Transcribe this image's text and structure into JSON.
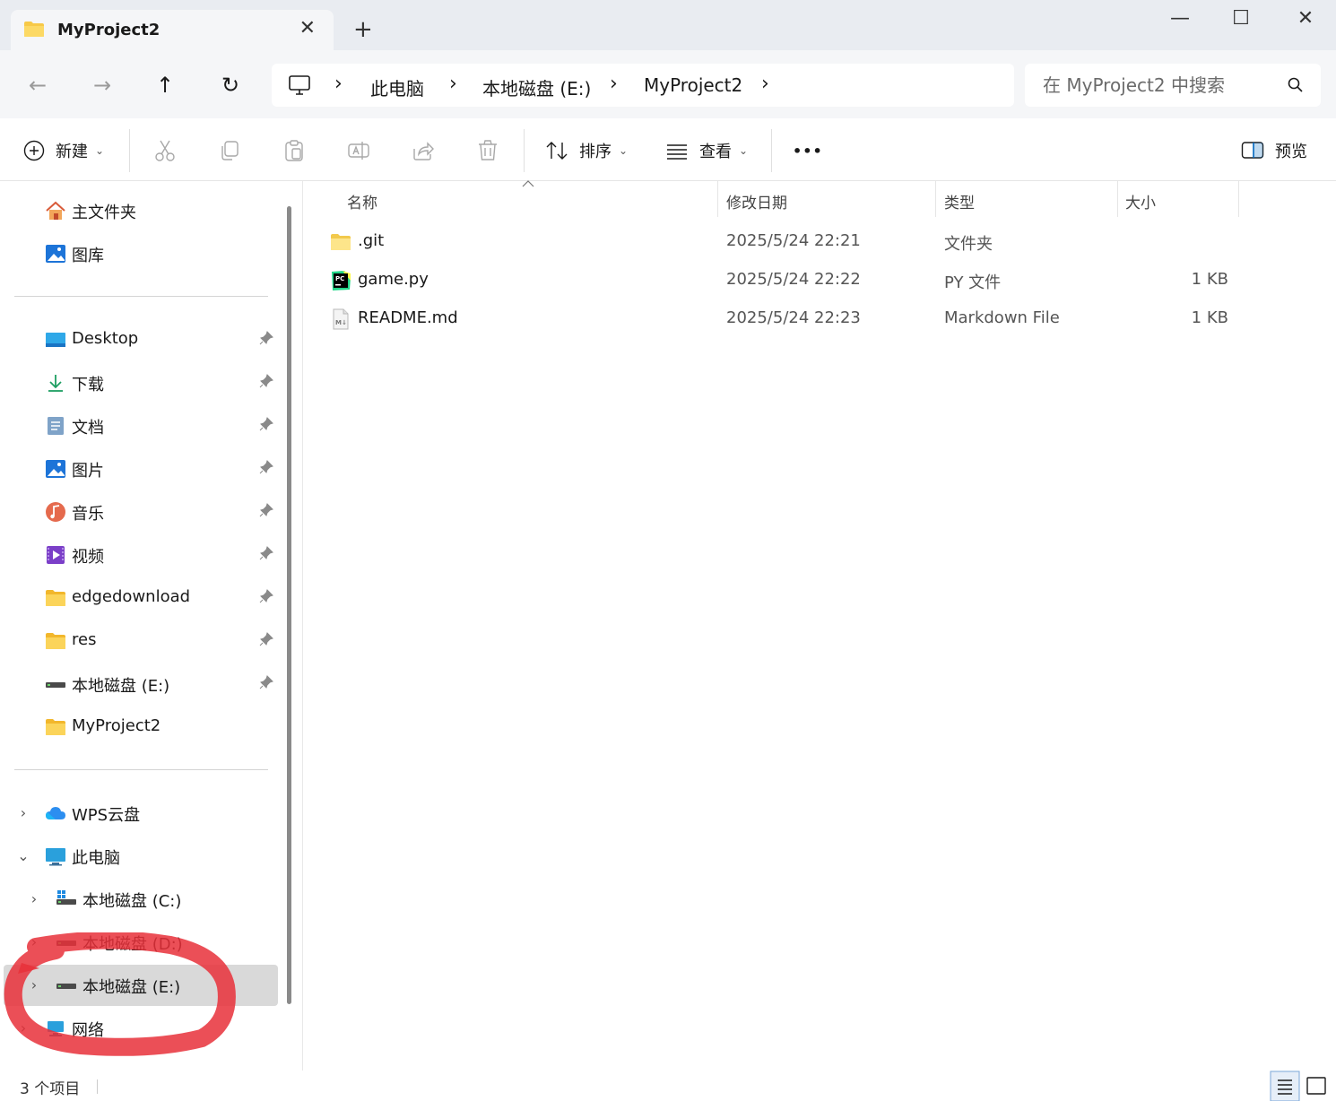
{
  "window": {
    "tab_title": "MyProject2",
    "tab_close": "✕",
    "new_tab": "+",
    "minimize": "—",
    "maximize": "☐",
    "close": "✕"
  },
  "navigation": {
    "back": "←",
    "forward": "→",
    "up": "↑",
    "refresh": "↻",
    "breadcrumb": [
      "此电脑",
      "本地磁盘 (E:)",
      "MyProject2"
    ],
    "search_placeholder": "在 MyProject2 中搜索"
  },
  "toolbar": {
    "new_label": "新建",
    "sort_label": "排序",
    "view_label": "查看",
    "more_label": "•••",
    "preview_label": "预览"
  },
  "sidebar": {
    "top_items": [
      {
        "label": "主文件夹",
        "icon": "home-icon"
      },
      {
        "label": "图库",
        "icon": "gallery-icon"
      }
    ],
    "quick_access": [
      {
        "label": "Desktop",
        "icon": "desktop-icon",
        "pinned": true
      },
      {
        "label": "下载",
        "icon": "download-icon",
        "pinned": true
      },
      {
        "label": "文档",
        "icon": "documents-icon",
        "pinned": true
      },
      {
        "label": "图片",
        "icon": "pictures-icon",
        "pinned": true
      },
      {
        "label": "音乐",
        "icon": "music-icon",
        "pinned": true
      },
      {
        "label": "视频",
        "icon": "videos-icon",
        "pinned": true
      },
      {
        "label": "edgedownload",
        "icon": "folder-icon",
        "pinned": true
      },
      {
        "label": "res",
        "icon": "folder-icon",
        "pinned": true
      },
      {
        "label": "本地磁盘 (E:)",
        "icon": "drive-icon",
        "pinned": true
      },
      {
        "label": "MyProject2",
        "icon": "folder-icon",
        "pinned": false
      }
    ],
    "tree": [
      {
        "label": "WPS云盘",
        "icon": "cloud-icon",
        "expanded": false,
        "indent": 0
      },
      {
        "label": "此电脑",
        "icon": "pc-icon",
        "expanded": true,
        "indent": 0
      },
      {
        "label": "本地磁盘 (C:)",
        "icon": "windows-drive-icon",
        "expanded": false,
        "indent": 1
      },
      {
        "label": "本地磁盘 (D:)",
        "icon": "drive-icon",
        "expanded": false,
        "indent": 1
      },
      {
        "label": "本地磁盘 (E:)",
        "icon": "drive-icon",
        "expanded": false,
        "indent": 1,
        "selected": true
      },
      {
        "label": "网络",
        "icon": "network-icon",
        "expanded": false,
        "indent": 0
      }
    ]
  },
  "filelist": {
    "columns": [
      "名称",
      "修改日期",
      "类型",
      "大小"
    ],
    "rows": [
      {
        "name": ".git",
        "date": "2025/5/24 22:21",
        "type": "文件夹",
        "size": "",
        "icon": "folder-icon"
      },
      {
        "name": "game.py",
        "date": "2025/5/24 22:22",
        "type": "PY 文件",
        "size": "1 KB",
        "icon": "pycharm-file-icon"
      },
      {
        "name": "README.md",
        "date": "2025/5/24 22:23",
        "type": "Markdown File",
        "size": "1 KB",
        "icon": "markdown-file-icon"
      }
    ]
  },
  "status": {
    "item_count": "3 个项目"
  },
  "colors": {
    "annotation": "#e8303a",
    "accent": "#0067c0",
    "folder": "#f7c948",
    "selected_bg": "#d9d9d9"
  }
}
